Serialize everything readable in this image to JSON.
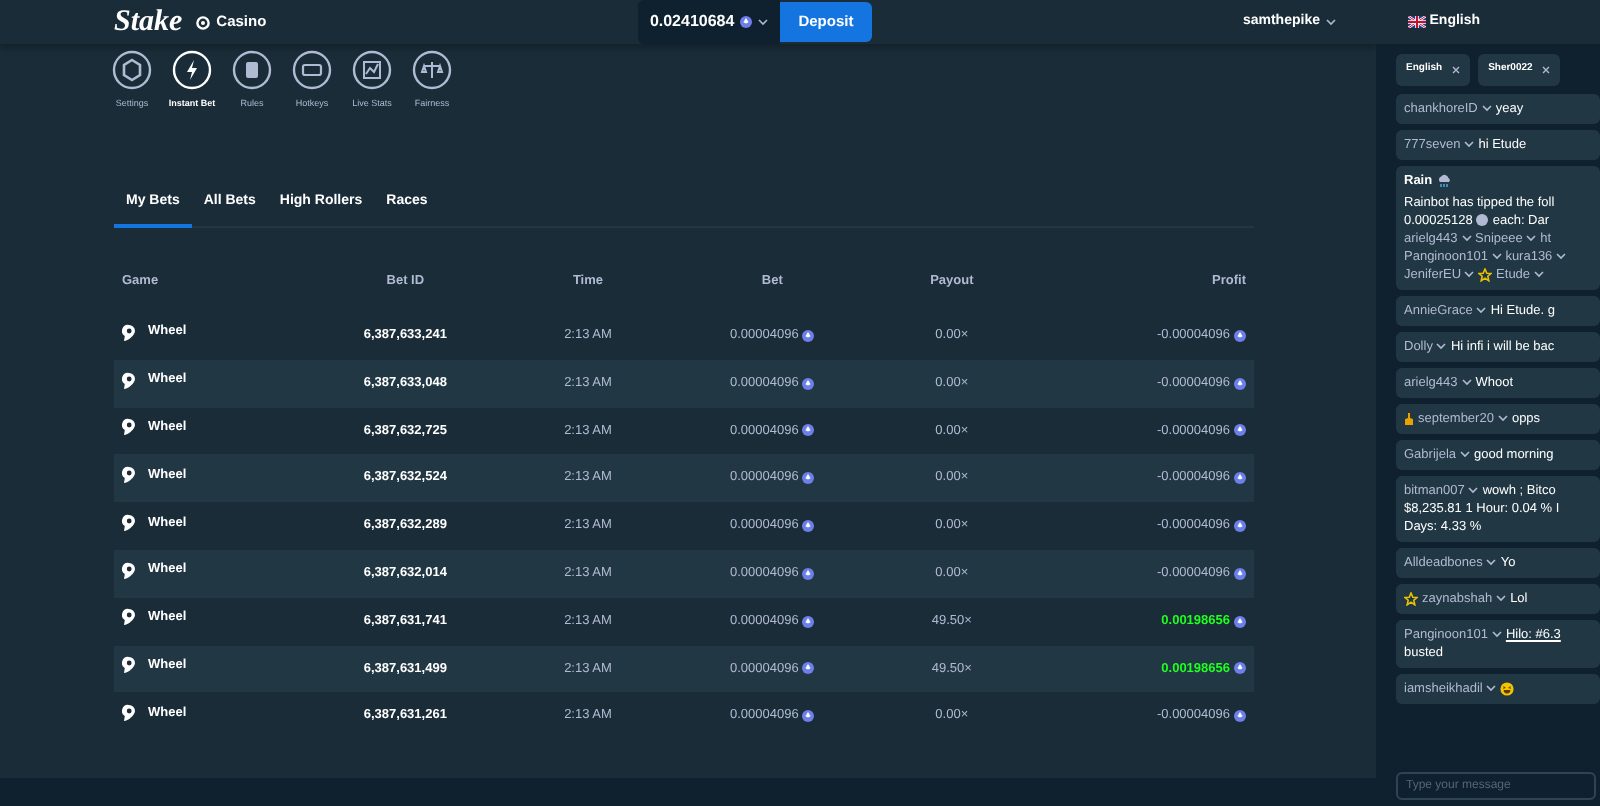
{
  "header": {
    "logo": "Stake",
    "nav": "Casino",
    "balance": "0.02410684",
    "deposit": "Deposit",
    "username": "samthepike"
  },
  "game_controls": [
    {
      "label": "Settings",
      "selected": false
    },
    {
      "label": "Instant Bet",
      "selected": true
    },
    {
      "label": "Rules",
      "selected": false
    },
    {
      "label": "Hotkeys",
      "selected": false
    },
    {
      "label": "Live Stats",
      "selected": false
    },
    {
      "label": "Fairness",
      "selected": false
    }
  ],
  "tabs": [
    {
      "label": "My Bets",
      "selected": true
    },
    {
      "label": "All Bets",
      "selected": false
    },
    {
      "label": "High Rollers",
      "selected": false
    },
    {
      "label": "Races",
      "selected": false
    }
  ],
  "table": {
    "columns": [
      "Game",
      "Bet ID",
      "Time",
      "Bet",
      "Payout",
      "Profit"
    ],
    "rows": [
      {
        "game": "Wheel",
        "bet_id": "6,387,633,241",
        "time": "2:13 AM",
        "bet": "0.00004096",
        "payout": "0.00×",
        "profit": "-0.00004096",
        "won": false
      },
      {
        "game": "Wheel",
        "bet_id": "6,387,633,048",
        "time": "2:13 AM",
        "bet": "0.00004096",
        "payout": "0.00×",
        "profit": "-0.00004096",
        "won": false
      },
      {
        "game": "Wheel",
        "bet_id": "6,387,632,725",
        "time": "2:13 AM",
        "bet": "0.00004096",
        "payout": "0.00×",
        "profit": "-0.00004096",
        "won": false
      },
      {
        "game": "Wheel",
        "bet_id": "6,387,632,524",
        "time": "2:13 AM",
        "bet": "0.00004096",
        "payout": "0.00×",
        "profit": "-0.00004096",
        "won": false
      },
      {
        "game": "Wheel",
        "bet_id": "6,387,632,289",
        "time": "2:13 AM",
        "bet": "0.00004096",
        "payout": "0.00×",
        "profit": "-0.00004096",
        "won": false
      },
      {
        "game": "Wheel",
        "bet_id": "6,387,632,014",
        "time": "2:13 AM",
        "bet": "0.00004096",
        "payout": "0.00×",
        "profit": "-0.00004096",
        "won": false
      },
      {
        "game": "Wheel",
        "bet_id": "6,387,631,741",
        "time": "2:13 AM",
        "bet": "0.00004096",
        "payout": "49.50×",
        "profit": "0.00198656",
        "won": true
      },
      {
        "game": "Wheel",
        "bet_id": "6,387,631,499",
        "time": "2:13 AM",
        "bet": "0.00004096",
        "payout": "49.50×",
        "profit": "0.00198656",
        "won": true
      },
      {
        "game": "Wheel",
        "bet_id": "6,387,631,261",
        "time": "2:13 AM",
        "bet": "0.00004096",
        "payout": "0.00×",
        "profit": "-0.00004096",
        "won": false
      }
    ]
  },
  "chat": {
    "language": "English",
    "tabs": [
      {
        "label": "English"
      },
      {
        "label": "Sher0022"
      }
    ],
    "messages": [
      {
        "kind": "plain",
        "user": "chankhoreID",
        "text": "yeay"
      },
      {
        "kind": "plain",
        "user": "777seven",
        "text": "hi Etude"
      },
      {
        "kind": "rain",
        "title": "Rain",
        "intro": "Rainbot has tipped the foll",
        "amount": "0.00025128",
        "amount_suffix": "each: Dar",
        "user_lines": [
          [
            {
              "name": "arielg443",
              "caret": true,
              "star": false
            },
            {
              "name": "Snipeee",
              "caret": true,
              "star": false
            },
            {
              "name": "ht",
              "caret": false,
              "star": false
            }
          ],
          [
            {
              "name": "Panginoon101",
              "caret": true,
              "star": false
            },
            {
              "name": "kura136",
              "caret": true,
              "star": false
            }
          ],
          [
            {
              "name": "JeniferEU",
              "caret": true,
              "star": false
            },
            {
              "name": "Etude",
              "caret": true,
              "star": true
            }
          ]
        ]
      },
      {
        "kind": "plain",
        "user": "AnnieGrace",
        "text": "Hi Etude. g"
      },
      {
        "kind": "plain",
        "user": "Dolly",
        "text": "Hi infi i will be bac"
      },
      {
        "kind": "plain",
        "user": "arielg443",
        "text": "Whoot"
      },
      {
        "kind": "hand",
        "user": "september20",
        "text": "opps"
      },
      {
        "kind": "plain",
        "user": "Gabrijela",
        "text": "good morning"
      },
      {
        "kind": "lines",
        "user": "bitman007",
        "lines": [
          "wowh ; Bitco",
          "$8,235.81 1 Hour: 0.04 % I",
          "Days: 4.33 %"
        ]
      },
      {
        "kind": "plain",
        "user": "Alldeadbones",
        "text": "Yo"
      },
      {
        "kind": "star",
        "user": "zaynabshah",
        "text": "Lol"
      },
      {
        "kind": "link",
        "user": "Panginoon101",
        "link": "Hilo: #6.3",
        "text": "busted"
      },
      {
        "kind": "emoji",
        "user": "iamsheikhadil"
      }
    ],
    "input": {
      "placeholder": "Type your message"
    }
  }
}
